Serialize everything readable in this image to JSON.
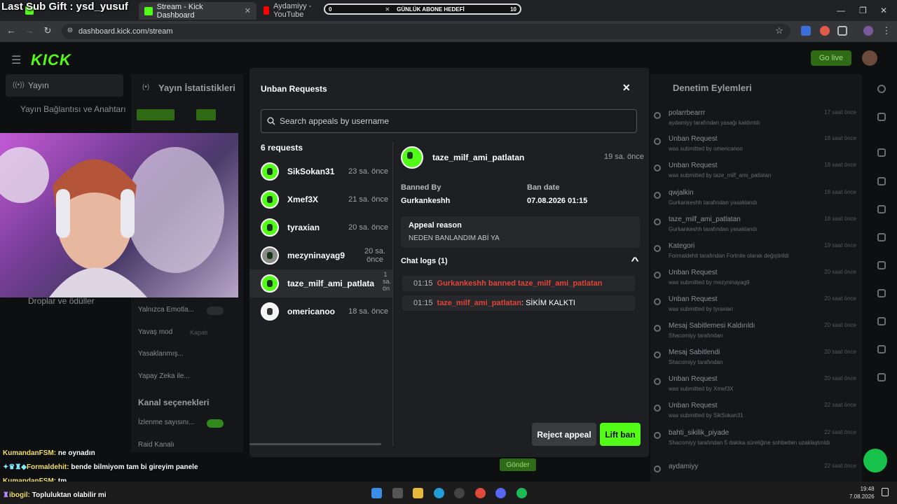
{
  "browser": {
    "tabs": [
      {
        "label": "Stream - Kick Dashboard"
      },
      {
        "label": "Aydamiyy - YouTube"
      }
    ],
    "url": "dashboard.kick.com/stream"
  },
  "overlay": {
    "sub_gift": "Last Sub Gift : ysd_yusuf",
    "goal_left": "0",
    "goal_label": "GÜNLÜK ABONE HEDEFİ",
    "goal_right": "10"
  },
  "dashboard": {
    "logo": "KICK",
    "go_live": "Go live",
    "sidebar": {
      "stream": "Yayın",
      "connection": "Yayın Bağlantısı ve Anahtarı",
      "drops": "Droplar ve ödüller"
    },
    "stats_title": "Yayın İstatistikleri",
    "settings": {
      "emotes_only": "Yalnızca Emotla...",
      "slow_mode": "Yavaş mod",
      "slow_off": "Kapalı",
      "banned": "Yasaklanmış...",
      "ai": "Yapay Zeka ile...",
      "channel_options": "Kanal seçenekleri",
      "view_count": "İzlenme sayısını...",
      "raid": "Raid Kanalı"
    },
    "send_button": "Gönder",
    "moderation_title": "Denetim Eylemleri",
    "mod_actions": [
      {
        "title": "polarrbearrr",
        "sub": "aydamiyy tarafından yasağı kaldırıldı",
        "time": "17 saat önce"
      },
      {
        "title": "Unban Request",
        "sub": "was submitted by omericanoo",
        "time": "18 saat önce"
      },
      {
        "title": "Unban Request",
        "sub": "was submitted by taze_milf_ami_patlatan",
        "time": "18 saat önce"
      },
      {
        "title": "qwjalkin",
        "sub": "Gurkankeshh tarafından yasaklandı",
        "time": "18 saat önce"
      },
      {
        "title": "taze_milf_ami_patlatan",
        "sub": "Gurkankeshh tarafından yasaklandı",
        "time": "18 saat önce"
      },
      {
        "title": "Kategori",
        "sub": "Formaldehit tarafından Fortnite olarak değiştirildi",
        "time": "19 saat önce"
      },
      {
        "title": "Unban Request",
        "sub": "was submitted by mezyninayag9",
        "time": "20 saat önce"
      },
      {
        "title": "Unban Request",
        "sub": "was submitted by tyraxian",
        "time": "20 saat önce"
      },
      {
        "title": "Mesaj Sabitlemesi Kaldırıldı",
        "sub": "Shacomiyy tarafından",
        "time": "20 saat önce"
      },
      {
        "title": "Mesaj Sabitlendi",
        "sub": "Shacomiyy tarafından",
        "time": "20 saat önce"
      },
      {
        "title": "Unban Request",
        "sub": "was submitted by Xmef3X",
        "time": "20 saat önce"
      },
      {
        "title": "Unban Request",
        "sub": "was submitted by SikSokan31",
        "time": "22 saat önce"
      },
      {
        "title": "bahti_sikilik_piyade",
        "sub": "Shacomiyy tarafından 5 dakika süreliğine sohbetten uzaklaştırıldı",
        "time": "22 saat önce"
      },
      {
        "title": "aydamiyy",
        "sub": "",
        "time": "22 saat önce"
      }
    ]
  },
  "modal": {
    "title": "Unban Requests",
    "search_placeholder": "Search appeals by username",
    "request_count": "6 requests",
    "requests": [
      {
        "name": "SikSokan31",
        "time": "23 sa. önce"
      },
      {
        "name": "Xmef3X",
        "time": "21 sa. önce"
      },
      {
        "name": "tyraxian",
        "time": "20 sa. önce"
      },
      {
        "name": "mezyninayag9",
        "time": "20 sa. önce"
      },
      {
        "name": "taze_milf_ami_patlatan",
        "time": "1 sa. ön"
      },
      {
        "name": "omericanoo",
        "time": "18 sa. önce"
      }
    ],
    "detail": {
      "username": "taze_milf_ami_patlatan",
      "time": "19 sa. önce",
      "banned_by_label": "Banned By",
      "banned_by": "Gurkankeshh",
      "ban_date_label": "Ban date",
      "ban_date": "07.08.2026 01:15",
      "appeal_reason_label": "Appeal reason",
      "appeal_reason": "NEDEN BANLANDIM ABİ YA",
      "chat_logs_label": "Chat logs (1)",
      "logs": [
        {
          "time": "01:15",
          "text": "Gurkankeshh banned taze_milf_ami_patlatan",
          "message": ""
        },
        {
          "time": "01:15",
          "text": "taze_milf_ami_patlatan",
          "message": ": SİKİM KALKTI"
        }
      ]
    },
    "reject_label": "Reject appeal",
    "lift_label": "Lift ban"
  },
  "stream_chat": [
    {
      "user": "KumandanFSM:",
      "msg": "ne oynadın"
    },
    {
      "user": "Formaldehit:",
      "msg": "bende bilmiyom tam bi gireyim panele"
    },
    {
      "user": "KumandanFSM:",
      "msg": "tm"
    },
    {
      "user": "ibogil:",
      "msg": "Topluluktan olabilir mi"
    }
  ],
  "taskbar": {
    "time": "19:48",
    "date": "7.08.2026"
  },
  "colors": {
    "kick_green": "#53fc18",
    "danger_red": "#e0453a",
    "modal_bg": "#1d1f23"
  }
}
